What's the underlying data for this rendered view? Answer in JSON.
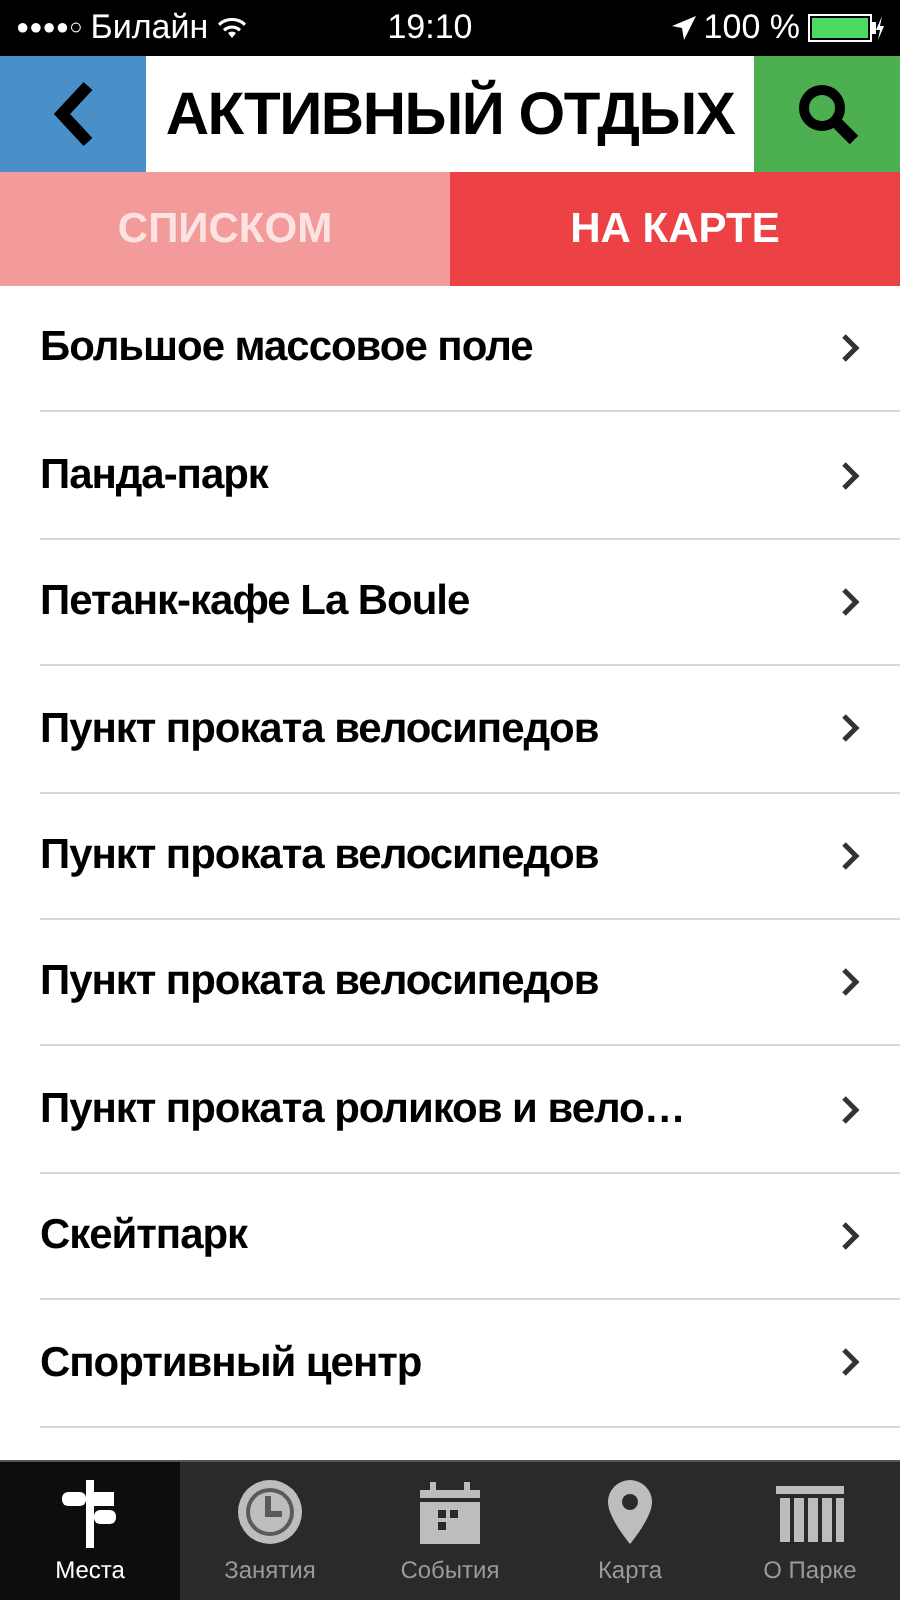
{
  "status_bar": {
    "signal": "●●●●○",
    "carrier": "Билайн",
    "time": "19:10",
    "battery": "100 %"
  },
  "header": {
    "title": "АКТИВНЫЙ ОТДЫХ"
  },
  "view_tabs": [
    {
      "label": "СПИСКОМ",
      "selected": true
    },
    {
      "label": "НА КАРТЕ",
      "selected": false
    }
  ],
  "places": [
    "Большое массовое поле",
    "Панда-парк",
    "Петанк-кафе La Boule",
    "Пункт проката велосипедов",
    "Пункт проката велосипедов",
    "Пункт проката велосипедов",
    "Пункт проката роликов и вело…",
    "Скейтпарк",
    "Спортивный центр"
  ],
  "tab_bar": [
    {
      "label": "Места",
      "kind": "signpost",
      "selected": true
    },
    {
      "label": "Занятия",
      "kind": "clock",
      "selected": false
    },
    {
      "label": "События",
      "kind": "calendar",
      "selected": false
    },
    {
      "label": "Карта",
      "kind": "pin",
      "selected": false
    },
    {
      "label": "О Парке",
      "kind": "gate",
      "selected": false
    }
  ]
}
